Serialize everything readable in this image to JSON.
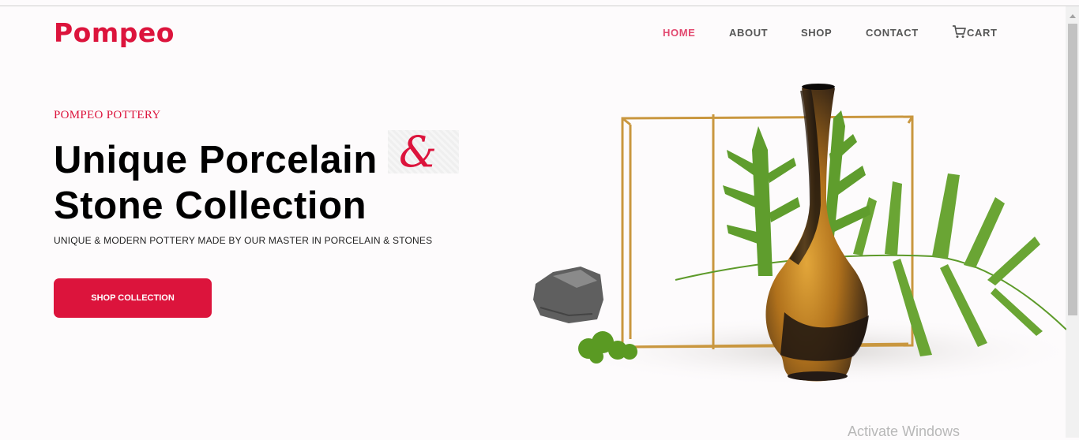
{
  "header": {
    "logo": "Pompeo",
    "nav": [
      {
        "label": "HOME",
        "active": true
      },
      {
        "label": "ABOUT",
        "active": false
      },
      {
        "label": "SHOP",
        "active": false
      },
      {
        "label": "CONTACT",
        "active": false
      },
      {
        "label": "CART",
        "active": false,
        "icon": "cart-icon"
      }
    ]
  },
  "hero": {
    "eyebrow": "POMPEO POTTERY",
    "headline_line1": "Unique Porcelain",
    "ampersand": "&",
    "headline_line2": "Stone Collection",
    "subline": "UNIQUE & MODERN POTTERY MADE BY OUR MASTER IN PORCELAIN & STONES",
    "cta_label": "SHOP COLLECTION"
  },
  "system": {
    "watermark": "Activate Windows"
  },
  "colors": {
    "brand": "#dc143c",
    "nav_active": "#e2486f",
    "nav": "#555555",
    "background": "#fdfbfc"
  }
}
